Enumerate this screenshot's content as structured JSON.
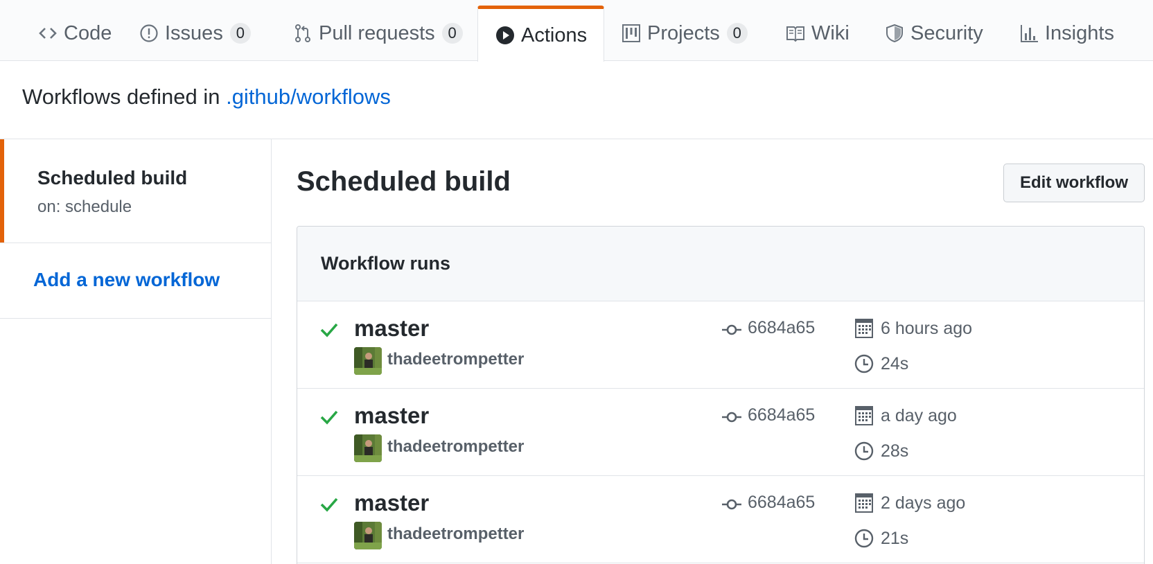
{
  "tabs": [
    {
      "label": "Code",
      "icon": "code-icon"
    },
    {
      "label": "Issues",
      "count": "0",
      "icon": "issue-opened-icon"
    },
    {
      "label": "Pull requests",
      "count": "0",
      "icon": "git-pull-request-icon"
    },
    {
      "label": "Actions",
      "icon": "play-icon",
      "selected": true
    },
    {
      "label": "Projects",
      "count": "0",
      "icon": "project-icon"
    },
    {
      "label": "Wiki",
      "icon": "book-icon"
    },
    {
      "label": "Security",
      "icon": "shield-icon"
    },
    {
      "label": "Insights",
      "icon": "graph-icon"
    }
  ],
  "header": {
    "prefix": "Workflows defined in",
    "link": ".github/workflows"
  },
  "sidebar": {
    "selected_title": "Scheduled build",
    "selected_trigger": "on: schedule",
    "add_link": "Add a new workflow"
  },
  "main": {
    "title": "Scheduled build",
    "edit_button": "Edit workflow",
    "runs_title": "Workflow runs",
    "runs": [
      {
        "branch": "master",
        "actor": "thadeetrompetter",
        "sha": "6684a65",
        "when": "6 hours ago",
        "duration": "24s",
        "status": "success"
      },
      {
        "branch": "master",
        "actor": "thadeetrompetter",
        "sha": "6684a65",
        "when": "a day ago",
        "duration": "28s",
        "status": "success"
      },
      {
        "branch": "master",
        "actor": "thadeetrompetter",
        "sha": "6684a65",
        "when": "2 days ago",
        "duration": "21s",
        "status": "success"
      }
    ]
  },
  "colors": {
    "accent": "#e36209",
    "link": "#0366d6",
    "success": "#28a745",
    "muted": "#586069"
  }
}
